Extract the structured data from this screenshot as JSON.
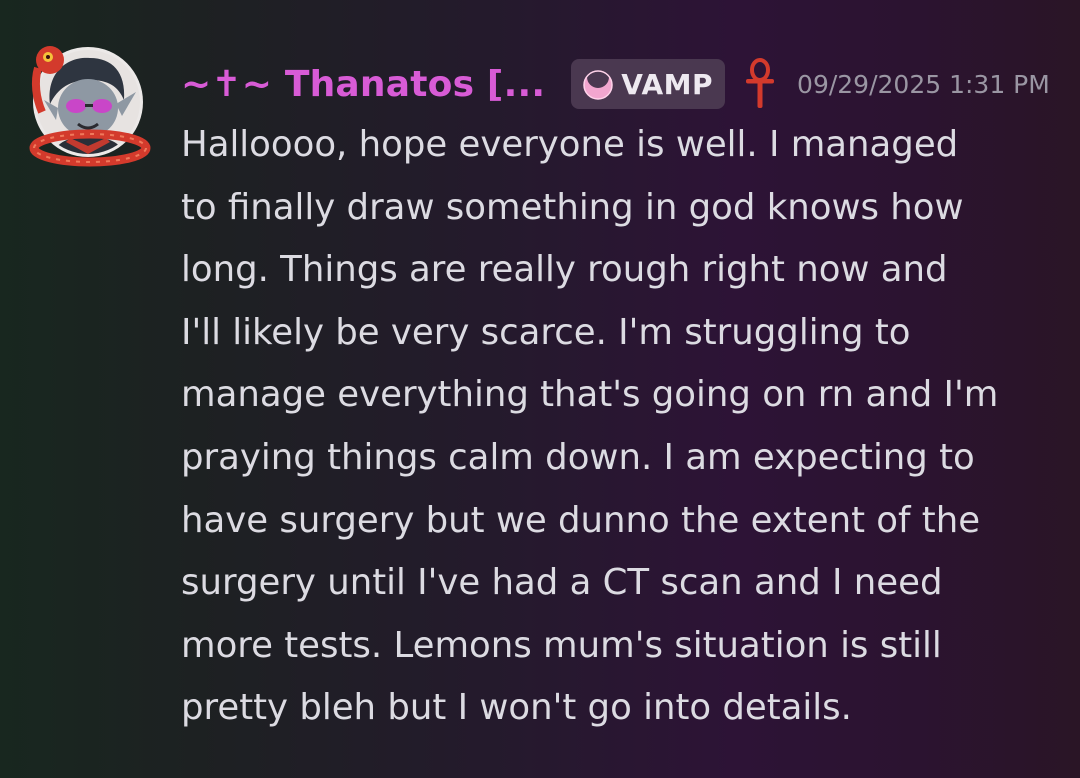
{
  "message": {
    "author": {
      "display_name": "~✝~ Thanatos [...",
      "name_color": "#d85bd6",
      "avatar_icon": "vampire-avatar-icon"
    },
    "guild_tag": {
      "icon": "crescent-moon-icon",
      "label": "VAMP"
    },
    "role_icon": "ankh-icon",
    "timestamp": "09/29/2025 1:31 PM",
    "lines": [
      "Halloooo, hope everyone is well. I managed",
      "to finally draw something in god knows how",
      "long. Things are really rough right now and",
      "I'll likely be very scarce. I'm struggling to",
      "manage everything that's going on rn and I'm",
      "praying things calm down. I am expecting to",
      "have surgery but we dunno the extent of the",
      "surgery until I've had a CT scan and I need",
      "more tests. Lemons mum's situation is still",
      "pretty bleh but I won't go into details."
    ]
  },
  "colors": {
    "text": "#dcdbe2",
    "timestamp": "#9a96a3",
    "badge_bg": "#4a3850",
    "accent_red": "#d33a2c"
  }
}
